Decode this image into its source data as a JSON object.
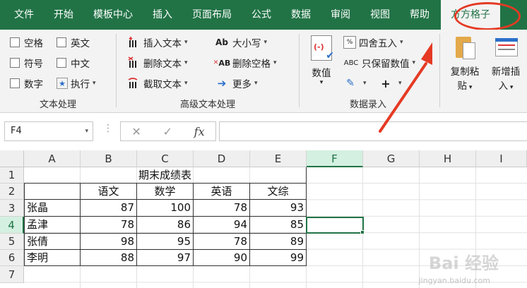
{
  "menu": [
    "文件",
    "开始",
    "模板中心",
    "插入",
    "页面布局",
    "公式",
    "数据",
    "审阅",
    "视图",
    "帮助"
  ],
  "active_tab": "方方格子",
  "ribbon": {
    "text_group": {
      "label": "文本处理",
      "checks": [
        "空格",
        "英文",
        "符号",
        "中文",
        "数字"
      ],
      "execute": "执行"
    },
    "adv_group": {
      "label": "高级文本处理",
      "insert_text": "插入文本",
      "delete_text": "删除文本",
      "extract_text": "截取文本",
      "case": "大小写",
      "delete_space": "删除空格",
      "more": "更多"
    },
    "data_group": {
      "label": "数据录入",
      "value_btn": "数值",
      "round": "四舍五入",
      "keep_value": "只保留数值"
    },
    "extra": {
      "copy_paste_line1": "复制粘",
      "copy_paste_line2": "贴",
      "new_insert_line1": "新增插",
      "new_insert_line2": "入"
    },
    "icons": {
      "insert_text": "insert-text-icon",
      "delete_text": "delete-text-icon",
      "extract_text": "extract-text-icon",
      "case": "letter-case-icon",
      "delete_space": "delete-space-icon",
      "more": "arrow-right-icon",
      "value": "value-icon",
      "round": "round-icon",
      "keep_value": "abc-icon",
      "edit": "edit-icon",
      "plus": "plus-icon",
      "copy": "clipboard-icon",
      "new": "new-insert-icon"
    }
  },
  "formula_bar": {
    "name_box": "F4",
    "cancel": "✕",
    "confirm": "✓",
    "fx": "fx",
    "value": ""
  },
  "columns": [
    "A",
    "B",
    "C",
    "D",
    "E",
    "F",
    "G",
    "H",
    "I"
  ],
  "rows": [
    "1",
    "2",
    "3",
    "4",
    "5",
    "6",
    "7"
  ],
  "sheet": {
    "title": "期末成绩表",
    "headers": [
      "",
      "语文",
      "数学",
      "英语",
      "文综"
    ],
    "data": [
      [
        "张晶",
        "87",
        "100",
        "78",
        "93"
      ],
      [
        "孟津",
        "78",
        "86",
        "94",
        "85"
      ],
      [
        "张倩",
        "98",
        "95",
        "78",
        "89"
      ],
      [
        "李明",
        "88",
        "97",
        "90",
        "99"
      ]
    ]
  },
  "selected_cell": "F4",
  "colors": {
    "excel_green": "#217346",
    "annotation_red": "#e53a24"
  },
  "watermark": {
    "brand": "Bai 经验",
    "url": "jingyan.baidu.com"
  }
}
